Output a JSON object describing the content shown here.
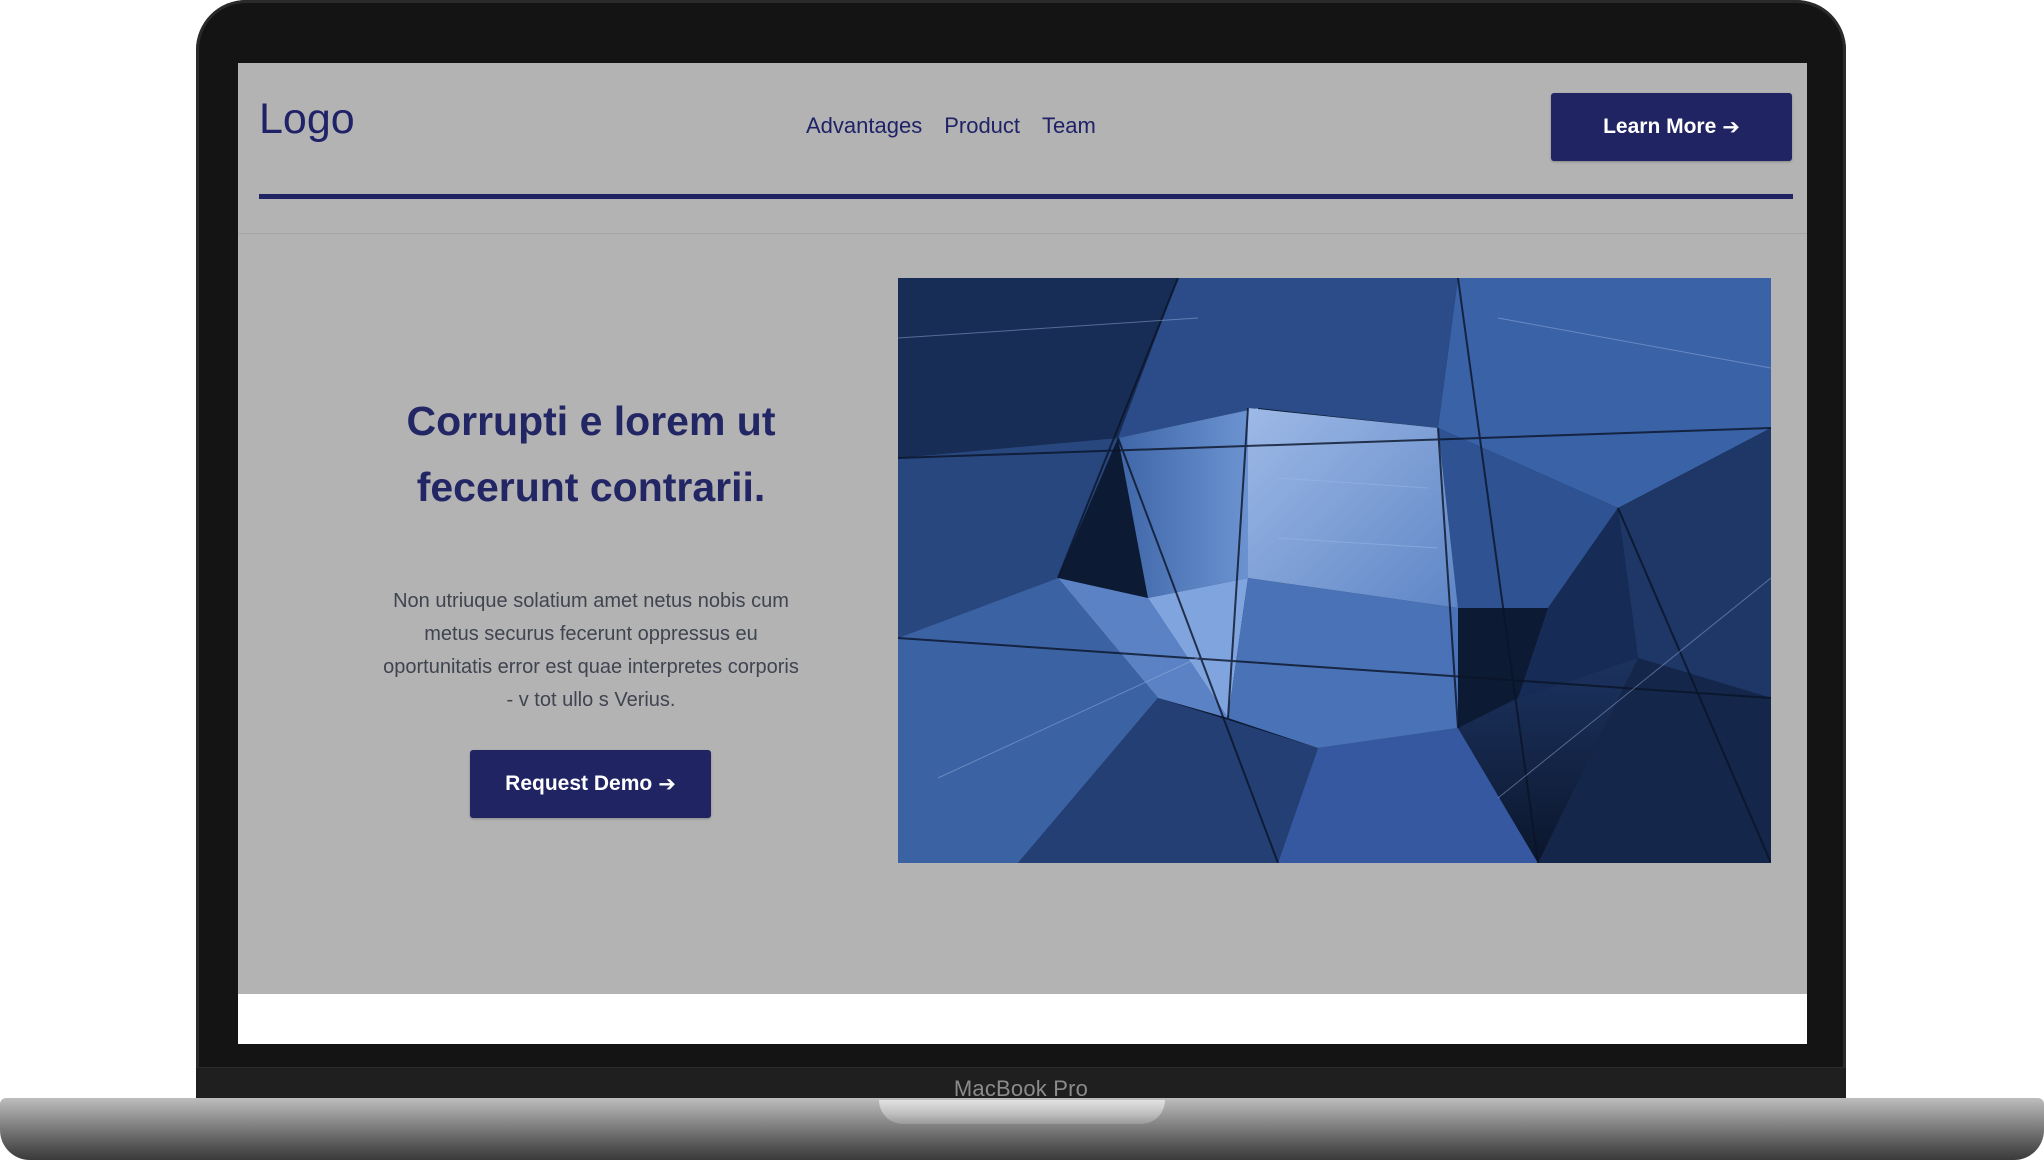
{
  "device": {
    "label": "MacBook Pro"
  },
  "site": {
    "logo": "Logo",
    "nav": {
      "items": [
        "Advantages",
        "Product",
        "Team"
      ]
    },
    "cta_header": {
      "label": "Learn More",
      "icon": "arrow-right-icon"
    },
    "hero": {
      "headline": "Corrupti e lorem ut fecerunt contrarii.",
      "body": "Non utriuque solatium amet netus nobis cum metus securus fecerunt oppressus eu oportunitatis error est quae interpretes corporis - v tot ullo s Verius.",
      "cta": {
        "label": "Request Demo",
        "icon": "arrow-right-icon"
      },
      "image": "architecture-photo"
    }
  },
  "colors": {
    "brand": "#212463",
    "page_background": "#b3b3b3",
    "body_text": "#3f4450"
  }
}
